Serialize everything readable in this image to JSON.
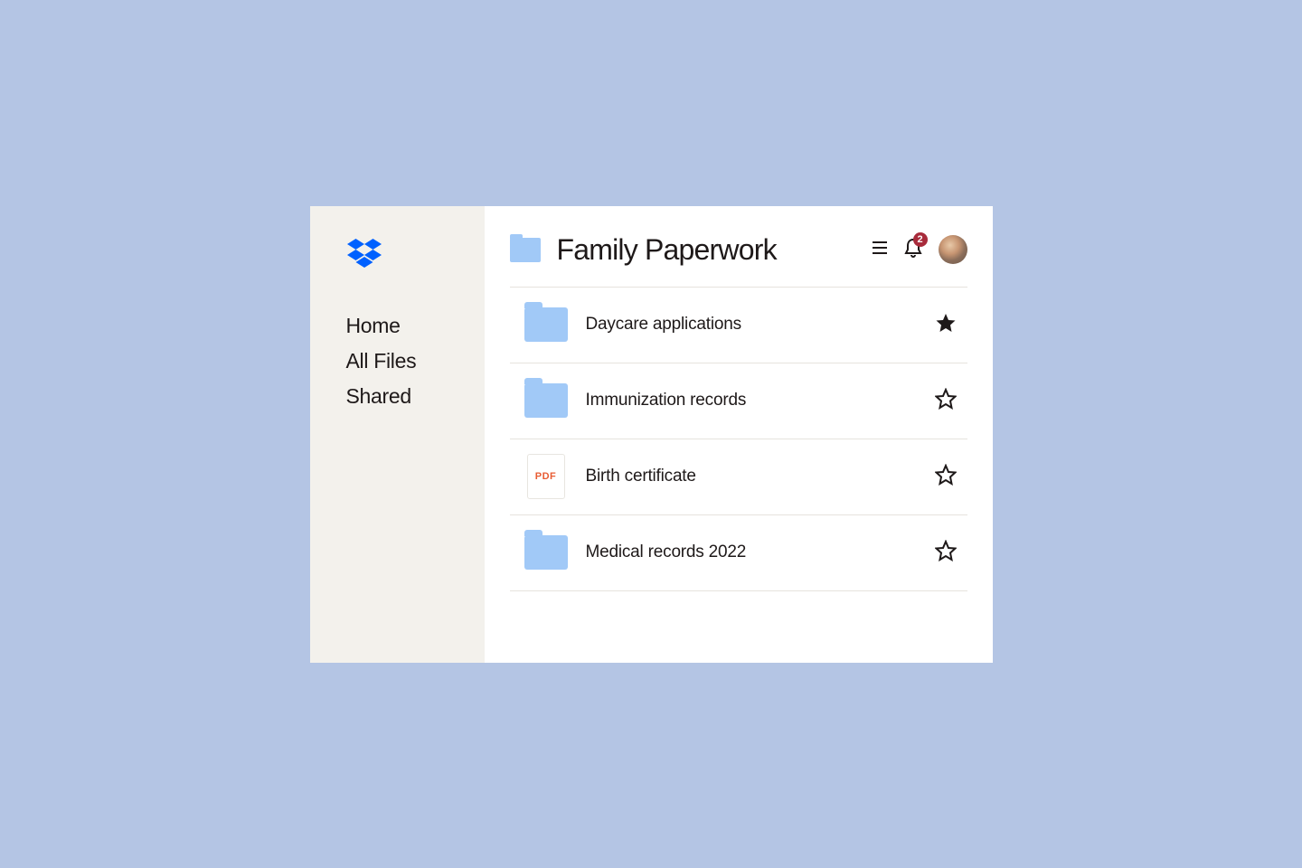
{
  "sidebar": {
    "items": [
      {
        "label": "Home"
      },
      {
        "label": "All Files"
      },
      {
        "label": "Shared"
      }
    ]
  },
  "header": {
    "title": "Family Paperwork",
    "notification_count": "2"
  },
  "files": [
    {
      "name": "Daycare applications",
      "type": "folder",
      "starred": true
    },
    {
      "name": "Immunization records",
      "type": "folder",
      "starred": false
    },
    {
      "name": "Birth certificate",
      "type": "pdf",
      "starred": false
    },
    {
      "name": "Medical records 2022",
      "type": "folder",
      "starred": false
    }
  ],
  "pdf_label": "PDF"
}
